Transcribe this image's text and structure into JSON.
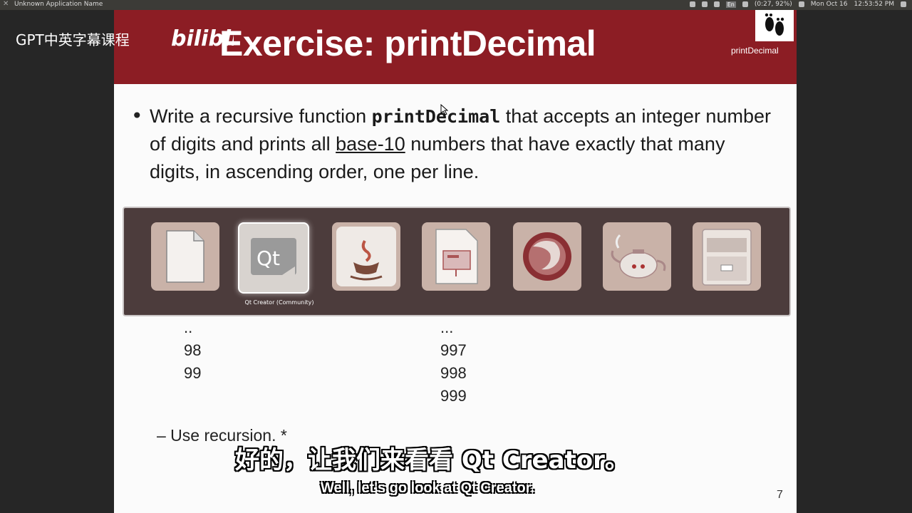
{
  "top_panel": {
    "app_name": "Unknown Application Name",
    "battery": "(0:27, 92%)",
    "date": "Mon Oct 16",
    "time": "12:53:52 PM",
    "keyboard": "En"
  },
  "watermark": {
    "text": "GPT中英字幕课程",
    "bilibili": "bilibili"
  },
  "slide": {
    "title": "Exercise: printDecimal",
    "logo_caption": "printDecimal",
    "bullet_prefix": "Write a recursive function ",
    "bullet_code": "printDecimal",
    "bullet_mid": " that accepts an integer number of digits and prints all ",
    "bullet_underlined": "base-10",
    "bullet_end": " numbers that have exactly that many digits, in ascending order, one per line.",
    "left_column": [
      "..",
      "98",
      "99"
    ],
    "right_column": [
      "...",
      "997",
      "998",
      "999"
    ],
    "sub_bullet": "– Use recursion. *",
    "page_number": "7"
  },
  "app_switcher": {
    "apps": [
      {
        "name": "LibreOffice",
        "icon": "libreoffice-icon"
      },
      {
        "name": "Qt Creator (Community)",
        "icon": "qt-icon"
      },
      {
        "name": "Java",
        "icon": "java-icon"
      },
      {
        "name": "Impress",
        "icon": "impress-icon"
      },
      {
        "name": "Firefox",
        "icon": "firefox-icon"
      },
      {
        "name": "Teapot",
        "icon": "teapot-icon"
      },
      {
        "name": "Files",
        "icon": "file-cabinet-icon"
      }
    ],
    "selected_label": "Qt Creator (Community)"
  },
  "subtitles": {
    "chinese": "好的，让我们来看看 Qt Creator。",
    "english": "Well, let's go look at Qt Creator."
  }
}
